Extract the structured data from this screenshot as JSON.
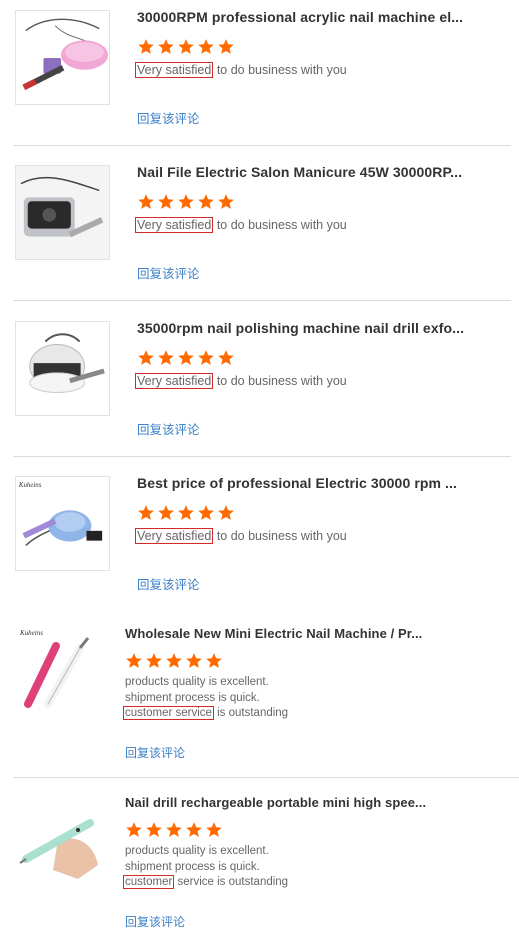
{
  "colors": {
    "star": "#ff6a00",
    "reply": "#3a7fc8",
    "highlight_border": "#d42a2a",
    "title": "#333333",
    "comment": "#666666"
  },
  "star_icon": "star-icon",
  "reviews": [
    {
      "title": "30000RPM professional acrylic nail machine el...",
      "rating": 5,
      "highlight": "Very satisfied",
      "rest": " to do business with you",
      "reply": "回复该评论",
      "image": "pink nail drill machine with handpiece"
    },
    {
      "title": "Nail File Electric Salon Manicure 45W 30000RP...",
      "rating": 5,
      "highlight": "Very satisfied",
      "rest": " to do business with you",
      "reply": "回复该评论",
      "image": "black and silver nail drill machine"
    },
    {
      "title": "35000rpm nail polishing machine nail drill exfo...",
      "rating": 5,
      "highlight": "Very satisfied",
      "rest": " to do business with you",
      "reply": "回复该评论",
      "image": "white nail polishing machine"
    },
    {
      "title": "Best price of professional Electric 30000 rpm ...",
      "rating": 5,
      "highlight": "Very satisfied",
      "rest": " to do business with you",
      "reply": "回复该评论",
      "image": "blue nail drill machine",
      "brand": "Kuheins"
    },
    {
      "title": "Wholesale New Mini Electric Nail Machine / Pr...",
      "rating": 5,
      "line1": "products quality is excellent.",
      "line2": "shipment process is quick.",
      "highlight": "customer service",
      "rest": " is outstanding",
      "reply": "回复该评论",
      "image": "pink and white pen nail drills",
      "brand": "Kuheins"
    },
    {
      "title": "Nail drill rechargeable portable mini high spee...",
      "rating": 5,
      "line1": "products quality is excellent.",
      "line2": "shipment process is quick.",
      "highlight": "customer",
      "rest": " service is outstanding",
      "reply": "回复该评论",
      "image": "hand holding mint pen nail drill"
    }
  ]
}
